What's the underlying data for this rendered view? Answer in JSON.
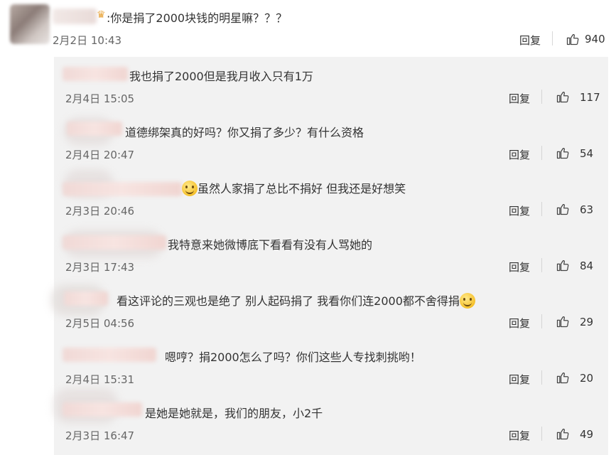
{
  "top_comment": {
    "text": ":你是捐了2000块钱的明星嘛？？？",
    "time": "2月2日 10:43",
    "reply_label": "回复",
    "likes": "940",
    "like_icon": "thumbs-up-icon"
  },
  "replies": [
    {
      "text": "我也捐了2000但是我月收入只有1万",
      "time": "2月4日 15:05",
      "reply_label": "回复",
      "likes": "117"
    },
    {
      "text": "道德绑架真的好吗？你又捐了多少？有什么资格",
      "time": "2月4日 20:47",
      "reply_label": "回复",
      "likes": "54"
    },
    {
      "text": "虽然人家捐了总比不捐好 但我还是好想笑",
      "time": "2月3日 20:46",
      "reply_label": "回复",
      "likes": "63",
      "emoji": "laughing-tears-emoji"
    },
    {
      "text": "我特意来她微博底下看看有没有人骂她的",
      "time": "2月3日 17:43",
      "reply_label": "回复",
      "likes": "84"
    },
    {
      "text": "看这评论的三观也是绝了 别人起码捐了 我看你们连2000都不舍得捐",
      "time": "2月5日 04:56",
      "reply_label": "回复",
      "likes": "29",
      "emoji": "smile-emoji"
    },
    {
      "text": "嗯哼？捐2000怎么了吗？你们这些人专找刺挑哟！",
      "time": "2月4日 15:31",
      "reply_label": "回复",
      "likes": "20"
    },
    {
      "text": "是她是她就是，我们的朋友，小2千",
      "time": "2月3日 16:47",
      "reply_label": "回复",
      "likes": "49"
    }
  ],
  "colors": {
    "panel_bg": "#f2f2f2",
    "text": "#333333",
    "meta": "#666666"
  }
}
